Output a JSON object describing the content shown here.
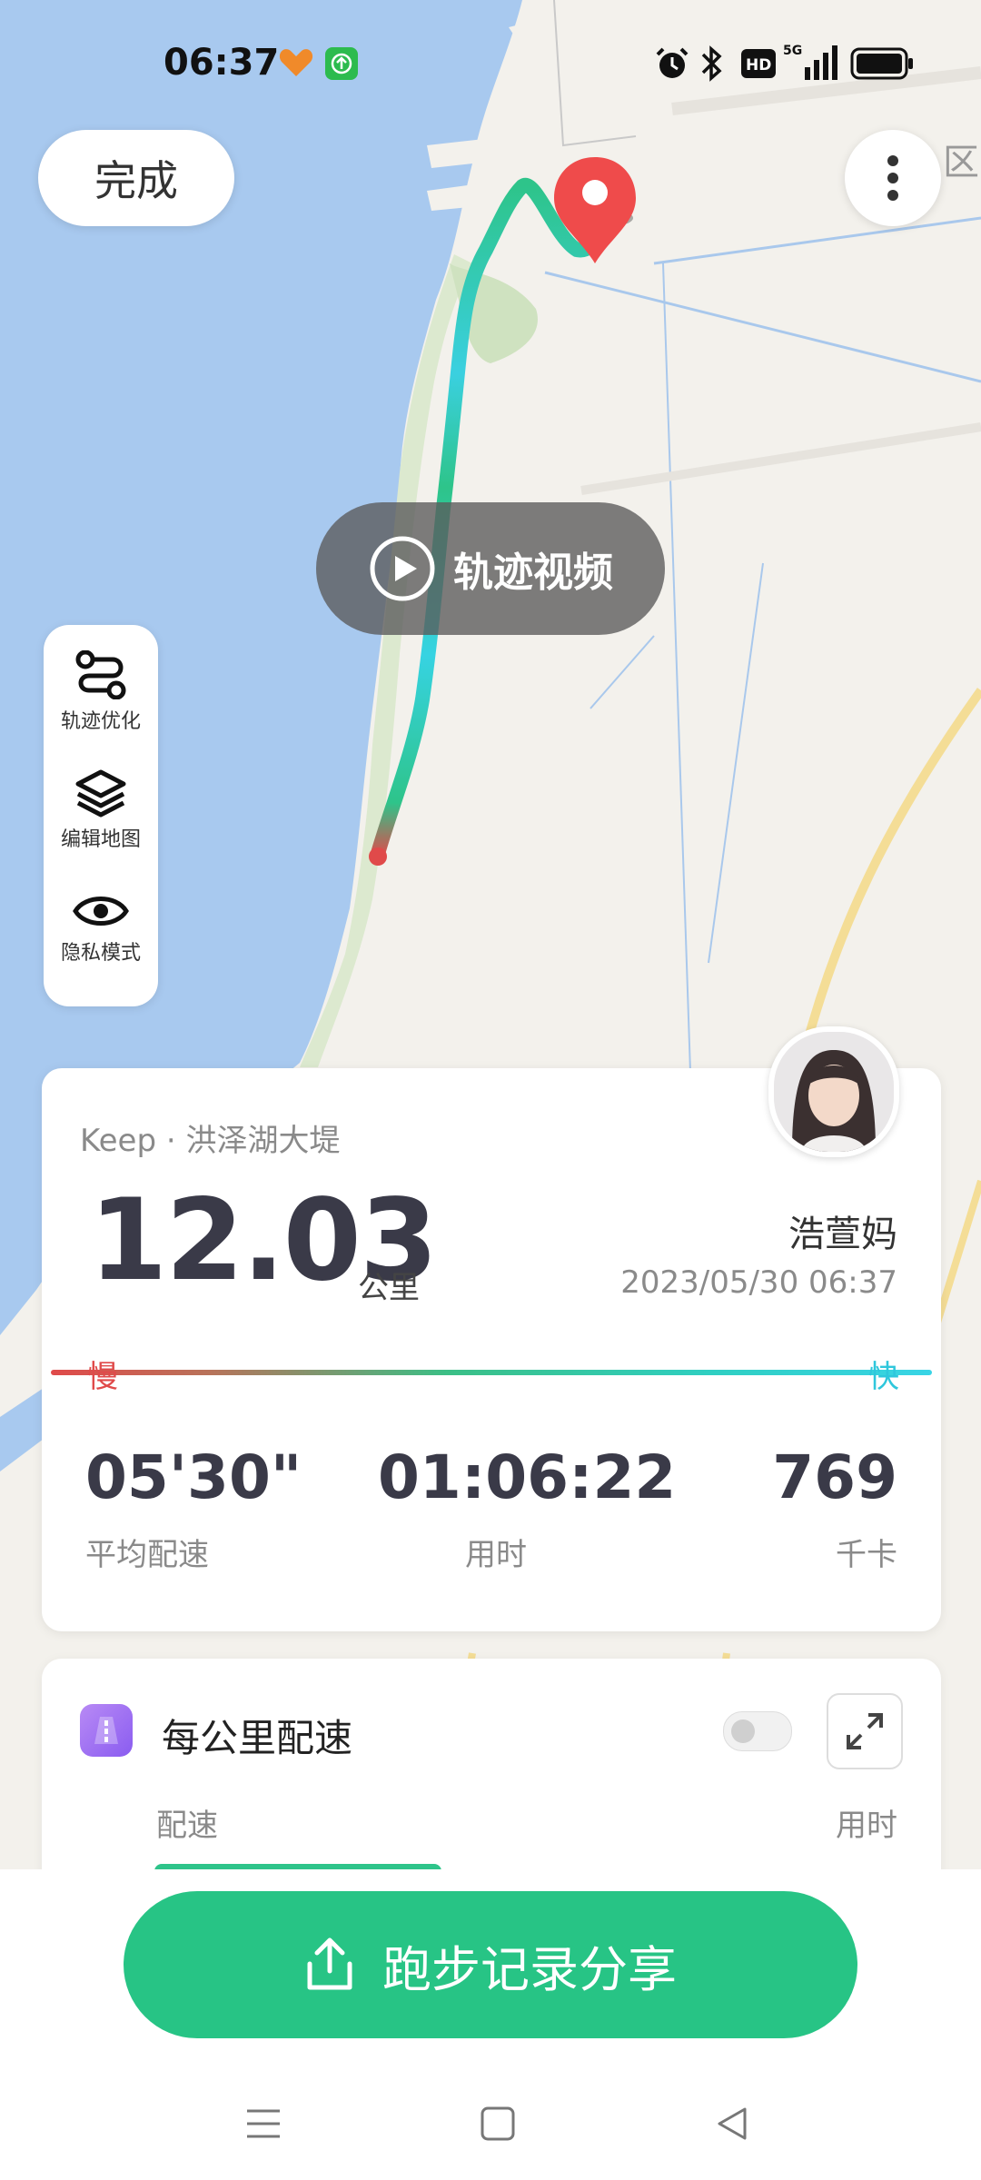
{
  "status_bar": {
    "time": "06:37"
  },
  "top": {
    "done_label": "完成",
    "track_video_label": "轨迹视频"
  },
  "tools": {
    "items": [
      {
        "label": "轨迹优化",
        "icon": "route-icon"
      },
      {
        "label": "编辑地图",
        "icon": "layers-icon"
      },
      {
        "label": "隐私模式",
        "icon": "eye-icon"
      }
    ]
  },
  "summary": {
    "source": "Keep · 洪泽湖大堤",
    "distance": "12.03",
    "distance_unit": "公里",
    "user_name": "浩萱妈",
    "datetime": "2023/05/30 06:37",
    "slow_label": "慢",
    "fast_label": "快",
    "metrics": [
      {
        "value": "05'30\"",
        "label": "平均配速"
      },
      {
        "value": "01:06:22",
        "label": "用时"
      },
      {
        "value": "769",
        "label": "千卡"
      }
    ]
  },
  "per_km": {
    "title": "每公里配速",
    "col_pace": "配速",
    "col_time": "用时"
  },
  "share": {
    "label": "跑步记录分享"
  },
  "colors": {
    "accent_green": "#27c485",
    "slow_red": "#e04a4a",
    "fast_cyan": "#2fc7dc",
    "water_blue": "#a7c8ef"
  }
}
